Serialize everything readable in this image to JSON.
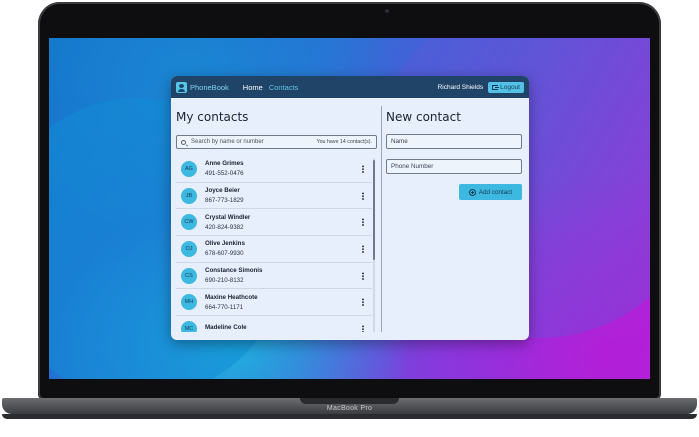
{
  "device": {
    "label": "MacBook Pro"
  },
  "nav": {
    "brand": "PhoneBook",
    "links": [
      "Home",
      "Contacts"
    ],
    "user": "Richard Shields",
    "logout": "Logout"
  },
  "contacts": {
    "title": "My contacts",
    "search_placeholder": "Search by name or number",
    "count_text": "You have 14 contact(s).",
    "items": [
      {
        "initials": "AG",
        "name": "Anne Grimes",
        "phone": "491-552-0476"
      },
      {
        "initials": "JB",
        "name": "Joyce Beier",
        "phone": "867-773-1829"
      },
      {
        "initials": "CW",
        "name": "Crystal Windler",
        "phone": "420-824-9382"
      },
      {
        "initials": "OJ",
        "name": "Olive Jenkins",
        "phone": "678-607-9930"
      },
      {
        "initials": "CS",
        "name": "Constance Simonis",
        "phone": "690-210-8132"
      },
      {
        "initials": "MH",
        "name": "Maxine Heathcote",
        "phone": "664-770-1171"
      },
      {
        "initials": "MC",
        "name": "Madeline Cole",
        "phone": ""
      }
    ]
  },
  "new_contact": {
    "title": "New contact",
    "name_placeholder": "Name",
    "phone_placeholder": "Phone Number",
    "add_label": "Add contact"
  },
  "colors": {
    "navbar": "#1f4468",
    "accent": "#3db8e0",
    "panel": "#e6effb"
  }
}
